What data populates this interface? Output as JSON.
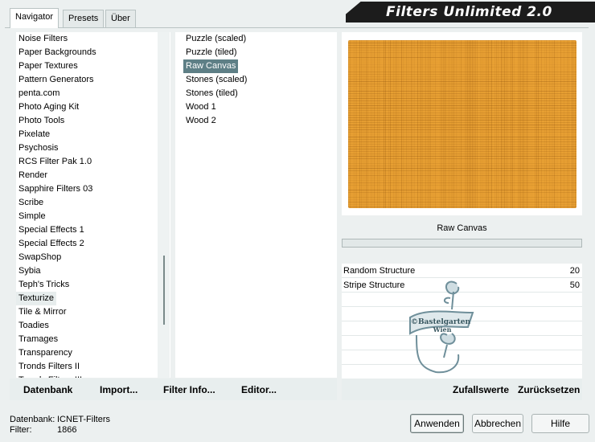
{
  "tabs": [
    {
      "label": "Navigator",
      "active": true
    },
    {
      "label": "Presets",
      "active": false
    },
    {
      "label": "Über",
      "active": false
    }
  ],
  "app_title": "Filters Unlimited 2.0",
  "categories": [
    "Noise Filters",
    "Paper Backgrounds",
    "Paper Textures",
    "Pattern Generators",
    "penta.com",
    "Photo Aging Kit",
    "Photo Tools",
    "Pixelate",
    "Psychosis",
    "RCS Filter Pak 1.0",
    "Render",
    "Sapphire Filters 03",
    "Scribe",
    "Simple",
    "Special Effects 1",
    "Special Effects 2",
    "SwapShop",
    "Sybia",
    "Teph's Tricks",
    "Texturize",
    "Tile & Mirror",
    "Toadies",
    "Tramages",
    "Transparency",
    "Tronds Filters II",
    "Tronds Filters III"
  ],
  "selected_category": "Texturize",
  "filters": [
    "Puzzle (scaled)",
    "Puzzle (tiled)",
    "Raw Canvas",
    "Stones (scaled)",
    "Stones (tiled)",
    "Wood 1",
    "Wood 2"
  ],
  "selected_filter": "Raw Canvas",
  "preview": {
    "filter_name": "Raw Canvas",
    "canvas_color": "#e8a033"
  },
  "params": [
    {
      "label": "Random Structure",
      "value": "20"
    },
    {
      "label": "Stripe Structure",
      "value": "50"
    }
  ],
  "watermark": {
    "text_line1": "©Bastelgarten",
    "text_line2": "Wien"
  },
  "bottom_links": {
    "datenbank": "Datenbank",
    "import": "Import...",
    "filter_info": "Filter Info...",
    "editor": "Editor...",
    "zufallswerte": "Zufallswerte",
    "zuruecksetzen": "Zurücksetzen"
  },
  "status": {
    "datenbank_label": "Datenbank:",
    "datenbank_value": "ICNET-Filters",
    "filter_label": "Filter:",
    "filter_value": "1866"
  },
  "buttons": {
    "apply": "Anwenden",
    "cancel": "Abbrechen",
    "help": "Hilfe"
  }
}
